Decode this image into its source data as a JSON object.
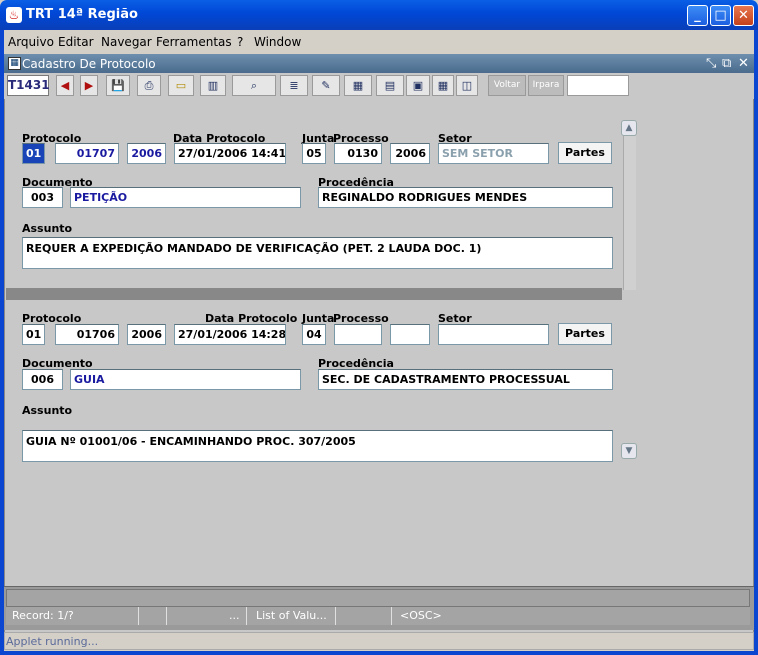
{
  "window": {
    "title": "TRT 14ª Região",
    "controls": [
      "minimize",
      "maximize",
      "close"
    ]
  },
  "menu": [
    "Arquivo",
    "Editar",
    "Navegar",
    "Ferramentas",
    "?",
    "Window"
  ],
  "form": {
    "title": "Cadastro De Protocolo",
    "code": "T1431"
  },
  "toolbar": {
    "voltar": "Voltar",
    "irpara": "Irpara"
  },
  "records": [
    {
      "labels": {
        "protocolo": "Protocolo",
        "data": "Data Protocolo",
        "junta": "Junta",
        "processo": "Processo",
        "setor": "Setor",
        "documento": "Documento",
        "procedencia": "Procedência",
        "assunto": "Assunto"
      },
      "protocolo_a": "01",
      "protocolo_b": "01707",
      "protocolo_c": "2006",
      "data": "27/01/2006 14:41",
      "junta": "05",
      "processo_a": "0130",
      "processo_b": "2006",
      "setor": "SEM SETOR",
      "partes": "Partes",
      "documento_cod": "003",
      "documento_nome": "PETIÇÃO",
      "procedencia": "REGINALDO RODRIGUES MENDES",
      "assunto": "REQUER A EXPEDIÇÃO MANDADO DE VERIFICAÇÃO (PET. 2 LAUDA DOC. 1)"
    },
    {
      "labels": {
        "protocolo": "Protocolo",
        "data": "Data Protocolo",
        "junta": "Junta",
        "processo": "Processo",
        "setor": "Setor",
        "documento": "Documento",
        "procedencia": "Procedência",
        "assunto": "Assunto"
      },
      "protocolo_a": "01",
      "protocolo_b": "01706",
      "protocolo_c": "2006",
      "data": "27/01/2006 14:28",
      "junta": "04",
      "processo_a": "",
      "processo_b": "",
      "setor": "",
      "partes": "Partes",
      "documento_cod": "006",
      "documento_nome": "GUIA",
      "procedencia": "SEC. DE CADASTRAMENTO PROCESSUAL",
      "assunto": "GUIA Nº 01001/06 - ENCAMINHANDO PROC. 307/2005"
    }
  ],
  "status": {
    "record": "Record: 1/?",
    "dots": "...",
    "lov": "List of Valu...",
    "osc": "<OSC>",
    "applet": "Applet running..."
  }
}
